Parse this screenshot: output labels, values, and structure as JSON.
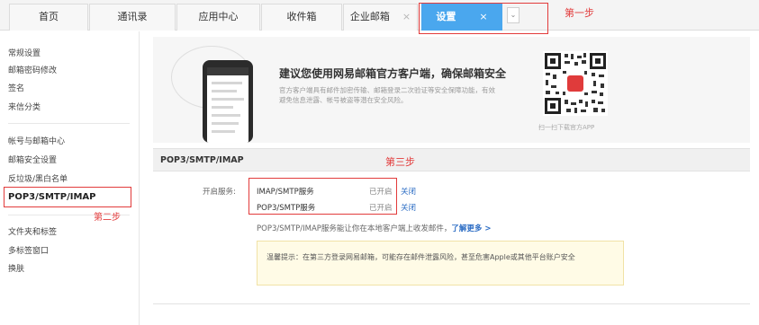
{
  "tabs": [
    {
      "label": "首页"
    },
    {
      "label": "通讯录"
    },
    {
      "label": "应用中心"
    },
    {
      "label": "收件箱"
    },
    {
      "label": "企业邮箱",
      "close": "×"
    },
    {
      "label": "设置",
      "close": "×",
      "active": true
    }
  ],
  "tab_dropdown": "⌄",
  "annotations": {
    "step1": "第一步",
    "step2": "第二步",
    "step3": "第三步"
  },
  "sidebar": {
    "groups": [
      [
        "常规设置",
        "邮箱密码修改",
        "签名",
        "来信分类"
      ],
      [
        "帐号与邮箱中心",
        "邮箱安全设置",
        "反垃圾/黑白名单",
        "POP3/SMTP/IMAP"
      ],
      [
        "文件夹和标签",
        "多标签窗口",
        "换肤"
      ]
    ],
    "active": "POP3/SMTP/IMAP"
  },
  "banner": {
    "title": "建议您使用网易邮箱官方客户端，确保邮箱安全",
    "desc": "官方客户端具有邮件加密传输、邮箱登录二次验证等安全保障功能，有效避免信息泄露、帐号被盗等潜在安全风险。",
    "qr_caption": "扫一扫下载官方APP",
    "qr_badge": "网"
  },
  "section": {
    "title": "POP3/SMTP/IMAP",
    "open_label": "开启服务:",
    "services": [
      {
        "name": "IMAP/SMTP服务",
        "status": "已开启",
        "action": "关闭"
      },
      {
        "name": "POP3/SMTP服务",
        "status": "已开启",
        "action": "关闭"
      }
    ],
    "note": "POP3/SMTP/IMAP服务能让你在本地客户端上收发邮件，",
    "learn_more": "了解更多 >",
    "tip": "温馨提示：在第三方登录网易邮箱，可能存在邮件泄露风险，甚至危害Apple或其他平台账户安全"
  },
  "colors": {
    "accent": "#4aa7ee",
    "annotation": "#e23b3b",
    "link": "#2b6cc4"
  }
}
